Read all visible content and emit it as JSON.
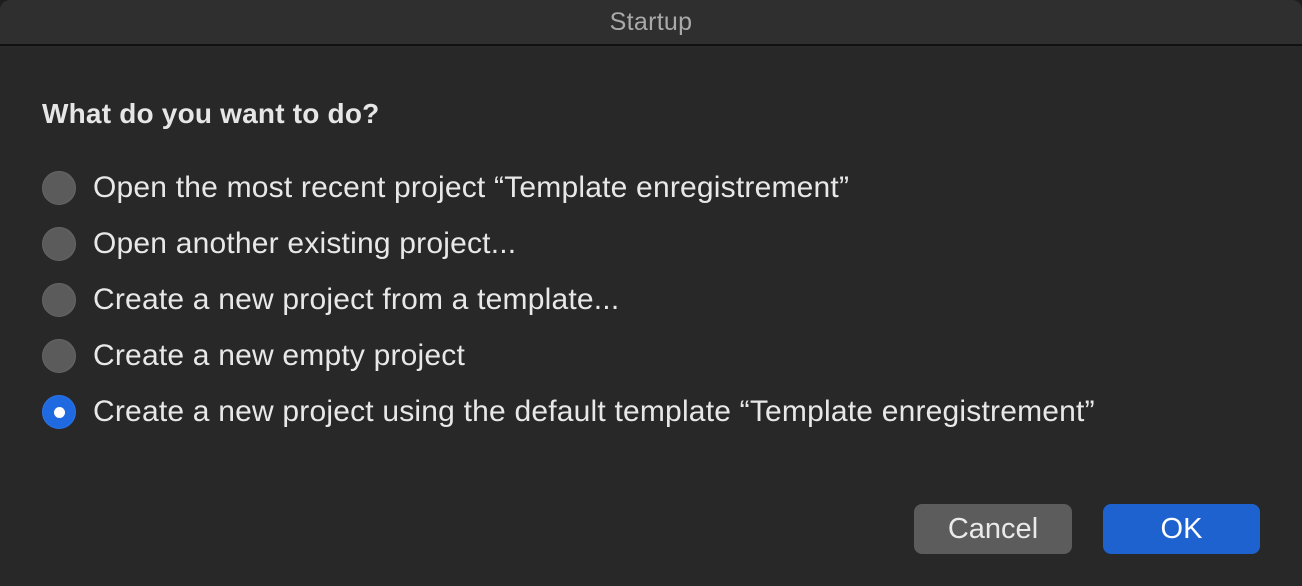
{
  "window": {
    "title": "Startup"
  },
  "question": "What do you want to do?",
  "options": [
    {
      "label": "Open the most recent project “Template enregistrement”",
      "selected": false
    },
    {
      "label": "Open another existing project...",
      "selected": false
    },
    {
      "label": "Create a new project from a template...",
      "selected": false
    },
    {
      "label": "Create a new empty project",
      "selected": false
    },
    {
      "label": "Create a new project using the default template “Template enregistrement”",
      "selected": true
    }
  ],
  "buttons": {
    "cancel_label": "Cancel",
    "ok_label": "OK"
  },
  "colors": {
    "accent": "#1e62d0",
    "background": "#282828",
    "radio_unselected": "#5b5b5b"
  }
}
